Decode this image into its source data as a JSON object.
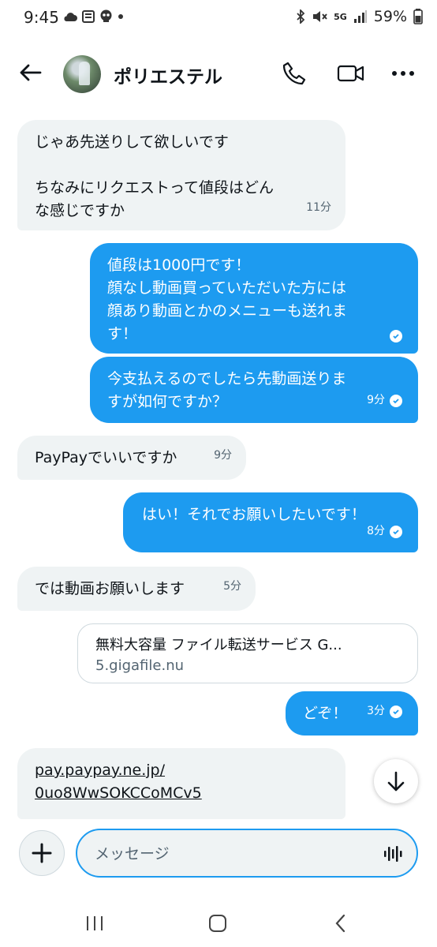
{
  "status_bar": {
    "time": "9:45",
    "network": "5G",
    "battery": "59%",
    "left_icons": [
      "cloud-icon",
      "news-icon",
      "skull-icon",
      "dot-icon"
    ],
    "right_icons": [
      "bluetooth-icon",
      "mute-icon",
      "signal-icon",
      "battery-icon"
    ]
  },
  "header": {
    "contact_name": "ポリエステル"
  },
  "messages": [
    {
      "direction": "received",
      "text": "じゃあ先送りして欲しいです\n\nちなみにリクエストって値段はどん\nな感じですか",
      "time": "11分"
    },
    {
      "direction": "sent",
      "text": "値段は1000円です！\n顔なし動画買っていただいた方には\n顔あり動画とかのメニューも送れま\nす！",
      "time": "",
      "read": true
    },
    {
      "direction": "sent",
      "text": "今支払えるのでしたら先動画送りま\nすが如何ですか？",
      "time": "9分",
      "read": true
    },
    {
      "direction": "received",
      "text": "PayPayでいいですか",
      "time": "9分"
    },
    {
      "direction": "sent",
      "text": "はい！それでお願いしたいです！",
      "time": "8分",
      "read": true
    },
    {
      "direction": "received",
      "text": "では動画お願いします",
      "time": "5分"
    },
    {
      "direction": "sent",
      "text": "どぞ！",
      "time": "3分",
      "read": true
    },
    {
      "direction": "received",
      "text": "pay.paypay.ne.jp/\n0uo8WwSOKCCoMCv5",
      "time": ""
    }
  ],
  "link_card": {
    "title": "無料大容量 ファイル転送サービス G...",
    "domain": "5.gigafile.nu"
  },
  "composer": {
    "placeholder": "メッセージ"
  },
  "colors": {
    "accent": "#1d9bf0",
    "received_bubble": "#eff3f4",
    "text": "#0f1419",
    "muted": "#536471"
  }
}
